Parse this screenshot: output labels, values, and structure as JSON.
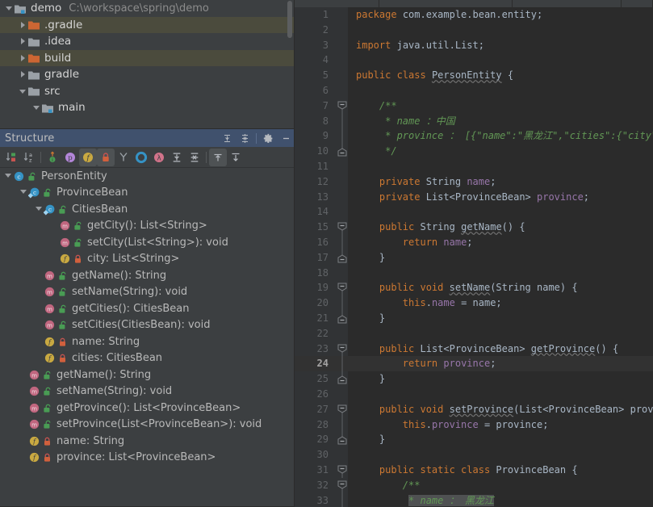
{
  "project": {
    "rows": [
      {
        "indent": 0,
        "arrow": "down",
        "icon": "module-folder-icon",
        "label": "demo",
        "path": "C:\\workspace\\spring\\demo",
        "highlight": false
      },
      {
        "indent": 1,
        "arrow": "right",
        "icon": "folder-excluded-icon",
        "label": ".gradle",
        "path": "",
        "highlight": true
      },
      {
        "indent": 1,
        "arrow": "right",
        "icon": "folder-icon",
        "label": ".idea",
        "path": "",
        "highlight": false
      },
      {
        "indent": 1,
        "arrow": "right",
        "icon": "folder-excluded-icon",
        "label": "build",
        "path": "",
        "highlight": true
      },
      {
        "indent": 1,
        "arrow": "right",
        "icon": "folder-icon",
        "label": "gradle",
        "path": "",
        "highlight": false
      },
      {
        "indent": 1,
        "arrow": "down",
        "icon": "folder-icon",
        "label": "src",
        "path": "",
        "highlight": false
      },
      {
        "indent": 2,
        "arrow": "down",
        "icon": "source-folder-icon",
        "label": "main",
        "path": "",
        "highlight": false
      }
    ]
  },
  "structure": {
    "title": "Structure",
    "header_buttons": [
      {
        "name": "expand-all-icon",
        "tooltip": "Expand All"
      },
      {
        "name": "collapse-all-icon",
        "tooltip": "Collapse All"
      },
      {
        "name": "gear-icon",
        "tooltip": "Settings"
      },
      {
        "name": "minimize-icon",
        "tooltip": "Hide"
      }
    ],
    "toolbar_buttons": [
      {
        "name": "sort-by-visibility-icon",
        "active": false
      },
      {
        "name": "sort-alphabetically-icon",
        "active": false
      },
      {
        "name": "show-inherited-icon",
        "active": false
      },
      {
        "name": "show-properties-icon",
        "active": false
      },
      {
        "name": "show-fields-icon",
        "active": true
      },
      {
        "name": "show-non-public-icon",
        "active": true
      },
      {
        "name": "show-anonymous-classes-icon",
        "active": false
      },
      {
        "name": "show-kotlin-objects-icon",
        "active": false
      },
      {
        "name": "show-lambdas-icon",
        "active": false
      },
      {
        "name": "expand-all-icon",
        "active": false
      },
      {
        "name": "collapse-all-icon",
        "active": false
      },
      {
        "name": "autoscroll-to-source-icon",
        "active": true
      },
      {
        "name": "autoscroll-from-source-icon",
        "active": false
      }
    ],
    "rows": [
      {
        "indent": 0,
        "twisty": "down",
        "kind": "class",
        "vis": "public",
        "label": "PersonEntity"
      },
      {
        "indent": 1,
        "twisty": "down",
        "kind": "static-class",
        "vis": "public",
        "label": "ProvinceBean"
      },
      {
        "indent": 2,
        "twisty": "down",
        "kind": "static-class",
        "vis": "public",
        "label": "CitiesBean"
      },
      {
        "indent": 3,
        "twisty": "none",
        "kind": "method",
        "vis": "public",
        "label": "getCity(): List<String>"
      },
      {
        "indent": 3,
        "twisty": "none",
        "kind": "method",
        "vis": "public",
        "label": "setCity(List<String>): void"
      },
      {
        "indent": 3,
        "twisty": "none",
        "kind": "field",
        "vis": "private",
        "label": "city: List<String>"
      },
      {
        "indent": 2,
        "twisty": "none",
        "kind": "method",
        "vis": "public",
        "label": "getName(): String"
      },
      {
        "indent": 2,
        "twisty": "none",
        "kind": "method",
        "vis": "public",
        "label": "setName(String): void"
      },
      {
        "indent": 2,
        "twisty": "none",
        "kind": "method",
        "vis": "public",
        "label": "getCities(): CitiesBean"
      },
      {
        "indent": 2,
        "twisty": "none",
        "kind": "method",
        "vis": "public",
        "label": "setCities(CitiesBean): void"
      },
      {
        "indent": 2,
        "twisty": "none",
        "kind": "field",
        "vis": "private",
        "label": "name: String"
      },
      {
        "indent": 2,
        "twisty": "none",
        "kind": "field",
        "vis": "private",
        "label": "cities: CitiesBean"
      },
      {
        "indent": 1,
        "twisty": "none",
        "kind": "method",
        "vis": "public",
        "label": "getName(): String"
      },
      {
        "indent": 1,
        "twisty": "none",
        "kind": "method",
        "vis": "public",
        "label": "setName(String): void"
      },
      {
        "indent": 1,
        "twisty": "none",
        "kind": "method",
        "vis": "public",
        "label": "getProvince(): List<ProvinceBean>"
      },
      {
        "indent": 1,
        "twisty": "none",
        "kind": "method",
        "vis": "public",
        "label": "setProvince(List<ProvinceBean>): void"
      },
      {
        "indent": 1,
        "twisty": "none",
        "kind": "field",
        "vis": "private",
        "label": "name: String"
      },
      {
        "indent": 1,
        "twisty": "none",
        "kind": "field",
        "vis": "private",
        "label": "province: List<ProvinceBean>"
      }
    ]
  },
  "editor": {
    "current_line": 24,
    "lines": [
      {
        "n": 1,
        "fold": "none",
        "html": "<span class=\"kw\">package</span> <span class=\"txt\">com.example.bean.entity;</span>"
      },
      {
        "n": 2,
        "fold": "none",
        "html": ""
      },
      {
        "n": 3,
        "fold": "none",
        "html": "<span class=\"kw\">import</span> <span class=\"txt\">java.util.List;</span>"
      },
      {
        "n": 4,
        "fold": "none",
        "html": ""
      },
      {
        "n": 5,
        "fold": "none",
        "html": "<span class=\"kw\">public class</span> <span class=\"txt err\">PersonEntity</span> <span class=\"txt\">{</span>"
      },
      {
        "n": 6,
        "fold": "none",
        "html": ""
      },
      {
        "n": 7,
        "fold": "start",
        "html": "    <span class=\"cmt\">/**</span>"
      },
      {
        "n": 8,
        "fold": "mid",
        "html": "     <span class=\"cmt\">* name ：<span class=\"cn\">中国</span></span>"
      },
      {
        "n": 9,
        "fold": "mid",
        "html": "     <span class=\"cmt\">* province ： [{\"name\":\"<span class=\"cn\">黑龙江</span>\",\"cities\":{\"city\":[\"<span class=\"cn\">哈尔滨</span>\",</span>"
      },
      {
        "n": 10,
        "fold": "end",
        "html": "     <span class=\"cmt\">*/</span>"
      },
      {
        "n": 11,
        "fold": "none",
        "html": ""
      },
      {
        "n": 12,
        "fold": "none",
        "html": "    <span class=\"kw\">private</span> <span class=\"txt\">String</span> <span class=\"fld\">name</span><span class=\"txt\">;</span>"
      },
      {
        "n": 13,
        "fold": "none",
        "html": "    <span class=\"kw\">private</span> <span class=\"txt\">List&lt;ProvinceBean&gt;</span> <span class=\"fld\">province</span><span class=\"txt\">;</span>"
      },
      {
        "n": 14,
        "fold": "none",
        "html": ""
      },
      {
        "n": 15,
        "fold": "start",
        "html": "    <span class=\"kw\">public</span> <span class=\"txt\">String</span> <span class=\"txt err\">getName</span><span class=\"txt\">() {</span>"
      },
      {
        "n": 16,
        "fold": "mid",
        "html": "        <span class=\"kw\">return</span> <span class=\"fld\">name</span><span class=\"txt\">;</span>"
      },
      {
        "n": 17,
        "fold": "end",
        "html": "    <span class=\"txt\">}</span>"
      },
      {
        "n": 18,
        "fold": "none",
        "html": ""
      },
      {
        "n": 19,
        "fold": "start",
        "html": "    <span class=\"kw\">public void</span> <span class=\"txt err\">setName</span><span class=\"txt\">(String name) {</span>"
      },
      {
        "n": 20,
        "fold": "mid",
        "html": "        <span class=\"kw\">this</span><span class=\"txt\">.</span><span class=\"fld\">name</span> <span class=\"txt\">= name;</span>"
      },
      {
        "n": 21,
        "fold": "end",
        "html": "    <span class=\"txt\">}</span>"
      },
      {
        "n": 22,
        "fold": "none",
        "html": ""
      },
      {
        "n": 23,
        "fold": "start",
        "html": "    <span class=\"kw\">public</span> <span class=\"txt\">List&lt;ProvinceBean&gt;</span> <span class=\"txt err\">getProvince</span><span class=\"txt\">() {</span>"
      },
      {
        "n": 24,
        "fold": "mid",
        "html": "        <span class=\"kw\">return</span> <span class=\"fld\">province</span><span class=\"txt\">;</span>"
      },
      {
        "n": 25,
        "fold": "end",
        "html": "    <span class=\"txt\">}</span>"
      },
      {
        "n": 26,
        "fold": "none",
        "html": ""
      },
      {
        "n": 27,
        "fold": "start",
        "html": "    <span class=\"kw\">public void</span> <span class=\"txt err\">setProvince</span><span class=\"txt\">(List&lt;ProvinceBean&gt; province) {</span>"
      },
      {
        "n": 28,
        "fold": "mid",
        "html": "        <span class=\"kw\">this</span><span class=\"txt\">.</span><span class=\"fld\">province</span> <span class=\"txt\">= province;</span>"
      },
      {
        "n": 29,
        "fold": "end",
        "html": "    <span class=\"txt\">}</span>"
      },
      {
        "n": 30,
        "fold": "none",
        "html": ""
      },
      {
        "n": 31,
        "fold": "start",
        "html": "    <span class=\"kw\">public static class</span> <span class=\"txt\">ProvinceBean {</span>"
      },
      {
        "n": 32,
        "fold": "start",
        "html": "        <span class=\"cmt\">/**</span>"
      },
      {
        "n": 33,
        "fold": "mid",
        "html": "         <span class=\"cmt sel-hl\">* name ： <span class=\"cn\">黑龙江</span></span>"
      }
    ]
  },
  "colors": {
    "editor_bg": "#2b2b2b",
    "gutter_bg": "#313335",
    "panel_bg": "#3c3f41",
    "structure_header_bg": "#40516d",
    "keyword": "#cc7832",
    "string": "#6a8759",
    "comment": "#629755",
    "field": "#9876aa",
    "text": "#a9b7c6",
    "tree_highlight": "#4b4b3d"
  }
}
